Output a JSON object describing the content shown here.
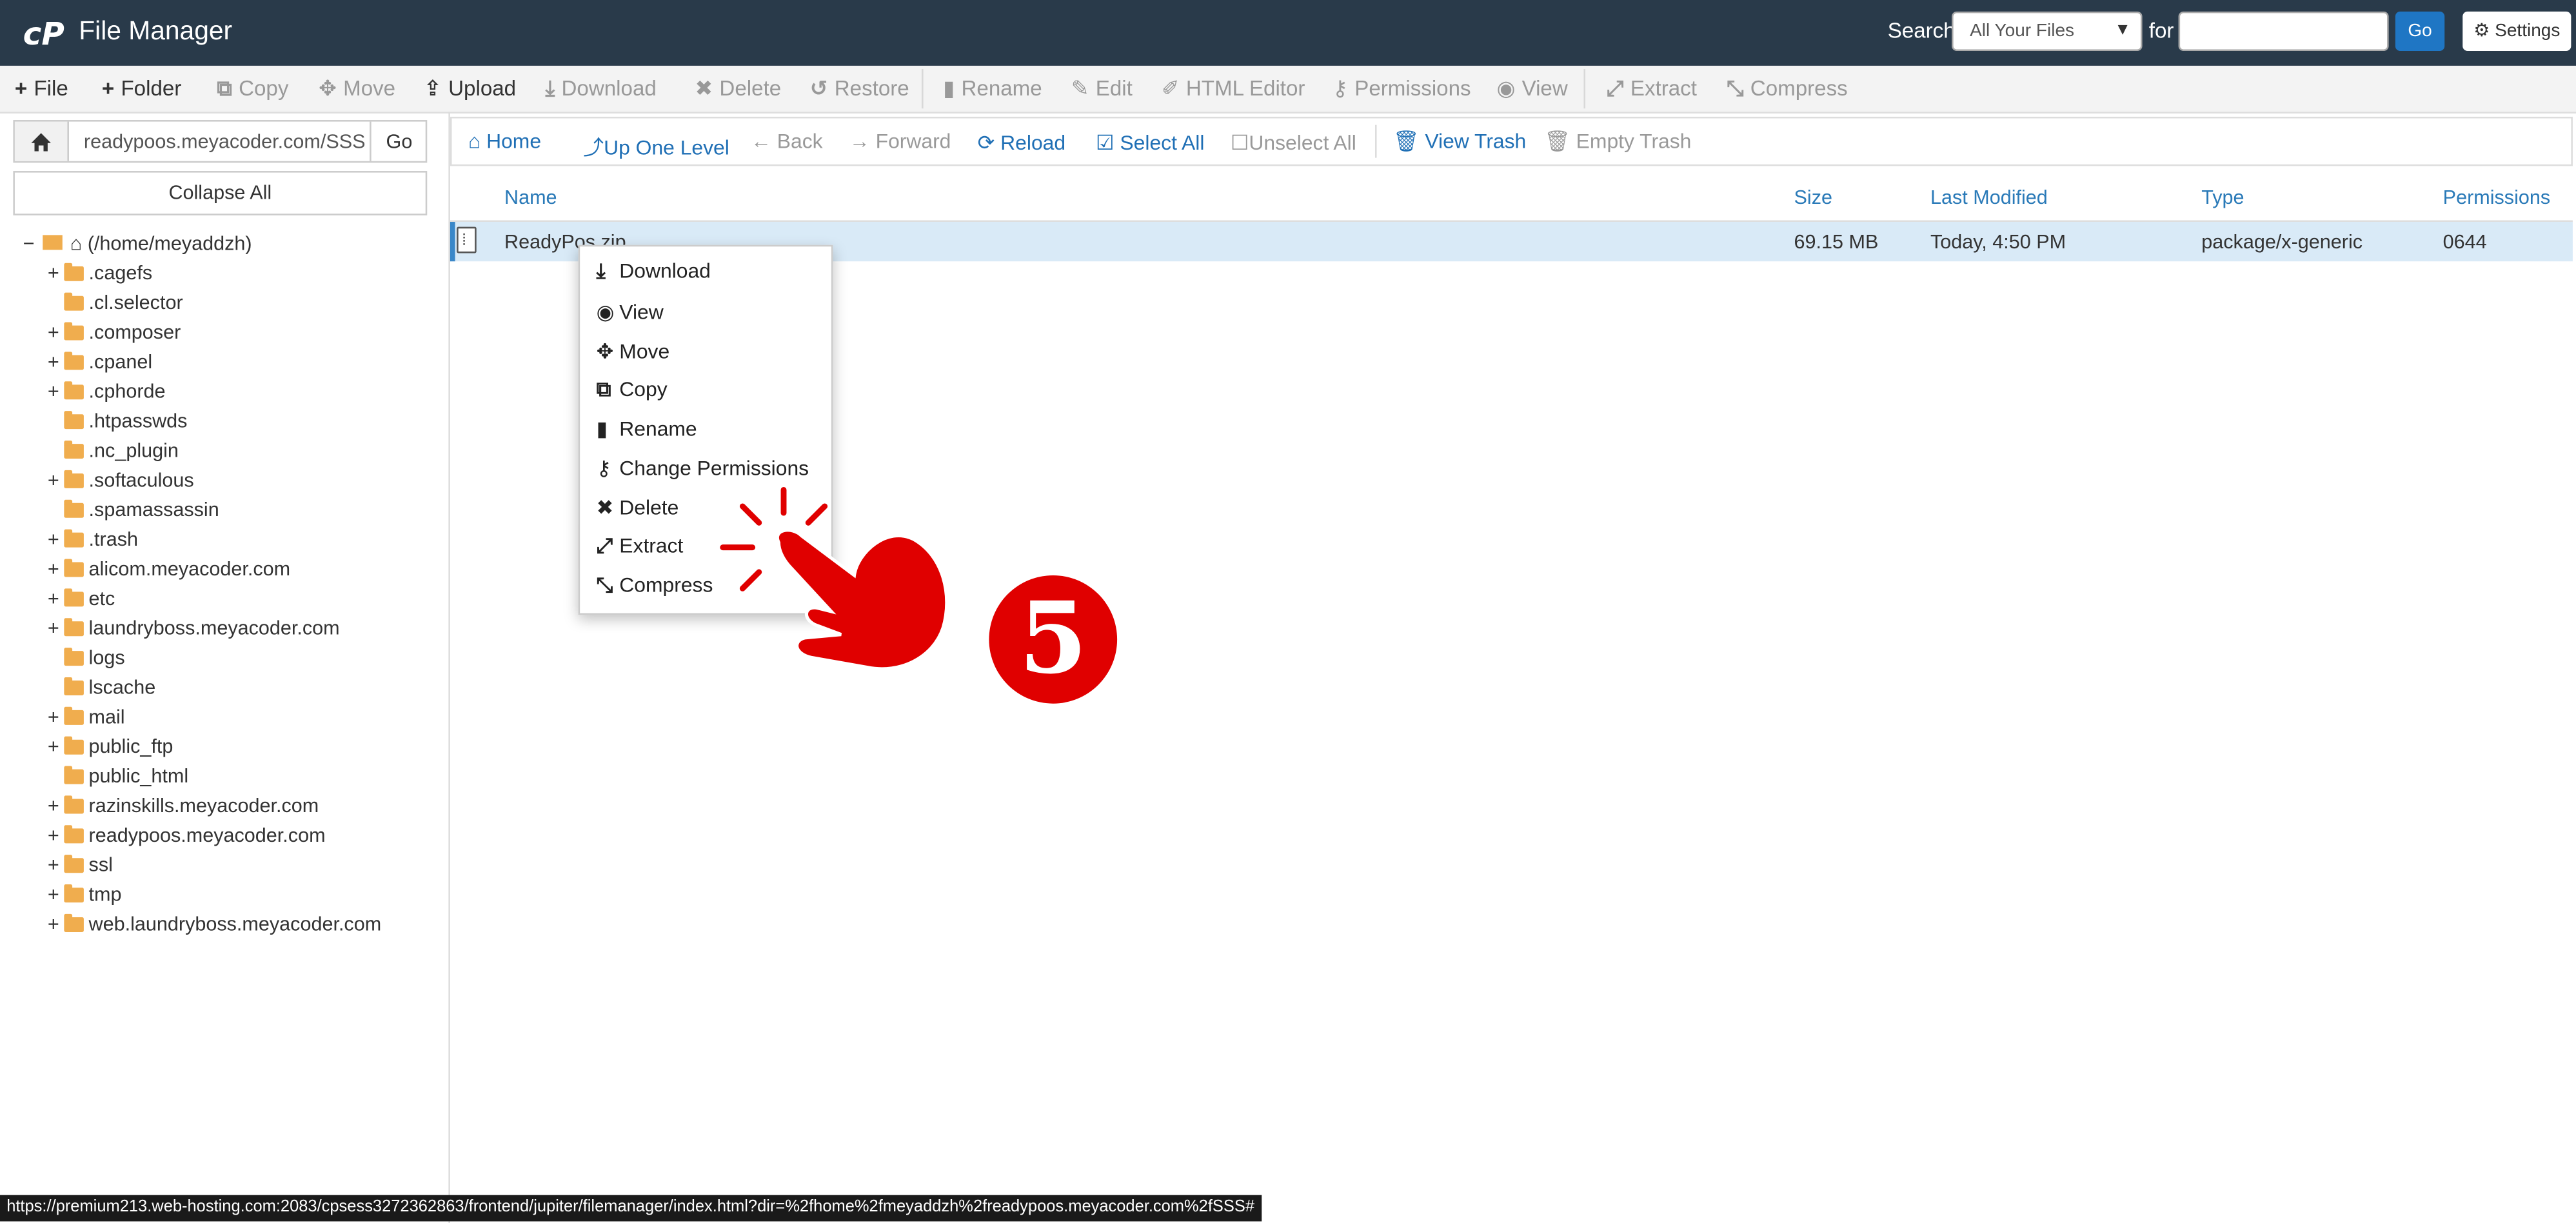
{
  "header": {
    "app_title": "File Manager",
    "search_label": "Search",
    "search_scope": "All Your Files",
    "for_label": "for",
    "search_value": "",
    "go_label": "Go",
    "settings_label": "Settings"
  },
  "toolbar": {
    "file": "File",
    "folder": "Folder",
    "copy": "Copy",
    "move": "Move",
    "upload": "Upload",
    "download": "Download",
    "delete": "Delete",
    "restore": "Restore",
    "rename": "Rename",
    "edit": "Edit",
    "html_editor": "HTML Editor",
    "permissions": "Permissions",
    "view": "View",
    "extract": "Extract",
    "compress": "Compress"
  },
  "sidebar": {
    "path_value": "readypoos.meyacoder.com/SSS",
    "go_label": "Go",
    "collapse_label": "Collapse All",
    "root_label": "(/home/meyaddzh)",
    "items": [
      {
        "name": ".cagefs",
        "expandable": "+"
      },
      {
        "name": ".cl.selector",
        "expandable": ""
      },
      {
        "name": ".composer",
        "expandable": "+"
      },
      {
        "name": ".cpanel",
        "expandable": "+"
      },
      {
        "name": ".cphorde",
        "expandable": "+"
      },
      {
        "name": ".htpasswds",
        "expandable": ""
      },
      {
        "name": ".nc_plugin",
        "expandable": ""
      },
      {
        "name": ".softaculous",
        "expandable": "+"
      },
      {
        "name": ".spamassassin",
        "expandable": ""
      },
      {
        "name": ".trash",
        "expandable": "+"
      },
      {
        "name": "alicom.meyacoder.com",
        "expandable": "+"
      },
      {
        "name": "etc",
        "expandable": "+"
      },
      {
        "name": "laundryboss.meyacoder.com",
        "expandable": "+"
      },
      {
        "name": "logs",
        "expandable": ""
      },
      {
        "name": "lscache",
        "expandable": ""
      },
      {
        "name": "mail",
        "expandable": "+"
      },
      {
        "name": "public_ftp",
        "expandable": "+"
      },
      {
        "name": "public_html",
        "expandable": ""
      },
      {
        "name": "razinskills.meyacoder.com",
        "expandable": "+"
      },
      {
        "name": "readypoos.meyacoder.com",
        "expandable": "+"
      },
      {
        "name": "ssl",
        "expandable": "+"
      },
      {
        "name": "tmp",
        "expandable": "+"
      },
      {
        "name": "web.laundryboss.meyacoder.com",
        "expandable": "+"
      }
    ]
  },
  "navbar": {
    "home": "Home",
    "up_one_level": "Up One Level",
    "back": "Back",
    "forward": "Forward",
    "reload": "Reload",
    "select_all": "Select All",
    "unselect_all": "Unselect All",
    "view_trash": "View Trash",
    "empty_trash": "Empty Trash"
  },
  "table": {
    "headers": {
      "name": "Name",
      "size": "Size",
      "modified": "Last Modified",
      "type": "Type",
      "permissions": "Permissions"
    },
    "rows": [
      {
        "name": "ReadyPos.zip",
        "size": "69.15 MB",
        "modified": "Today, 4:50 PM",
        "type": "package/x-generic",
        "permissions": "0644"
      }
    ]
  },
  "context_menu": {
    "items": [
      "Download",
      "View",
      "Move",
      "Copy",
      "Rename",
      "Change Permissions",
      "Delete",
      "Extract",
      "Compress"
    ],
    "highlighted": "Extract"
  },
  "status_url": "https://premium213.web-hosting.com:2083/cpsess3272362863/frontend/jupiter/filemanager/index.html?dir=%2fhome%2fmeyaddzh%2freadypoos.meyacoder.com%2fSSS#",
  "annotation": {
    "step": "5",
    "color": "#e00000"
  },
  "colors": {
    "header_bg": "#293a4a",
    "link": "#1f6fb5",
    "selected_row": "#d9eaf7",
    "folder": "#f0ad4e",
    "highlight": "#e02020"
  }
}
